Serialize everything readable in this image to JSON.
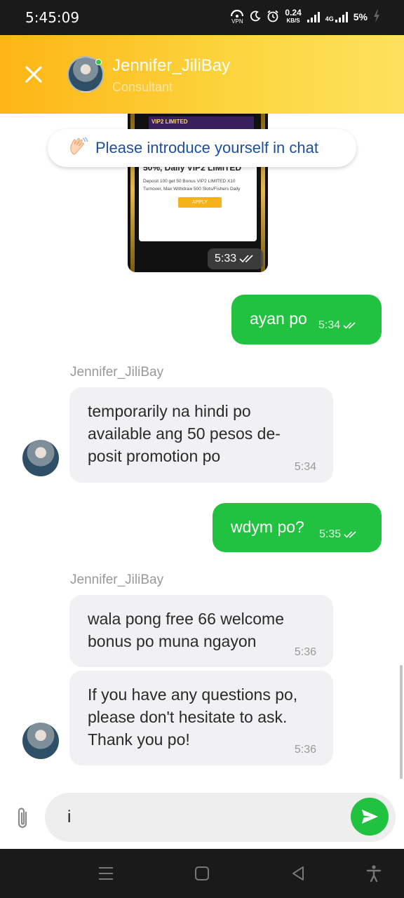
{
  "status_bar": {
    "time": "5:45:09",
    "vpn_label": "VPN",
    "speed_value": "0.24",
    "speed_unit": "KB/S",
    "network_label": "4G",
    "battery": "5%"
  },
  "header": {
    "agent_name": "Jennifer_JiliBay",
    "agent_role": "Consultant",
    "accent": "#fdb515"
  },
  "intro_banner": {
    "icon": "waving-hand-icon",
    "text": "Please introduce yourself in chat"
  },
  "image_message": {
    "banner_text": "VIP2 LIMITED",
    "promo_title": "50%, Daily VIP2 LIMITED",
    "promo_desc": "Deposit 100 get 50 Bonus VIP2 LIMITED X10 Turnover, Max Withdraw 500 Slots/Fishers Daily",
    "apply_label": "APPLY",
    "time": "5:33"
  },
  "messages": [
    {
      "direction": "out",
      "text": "ayan po",
      "time": "5:34"
    },
    {
      "direction": "in",
      "sender": "Jennifer_JiliBay",
      "text": "temporarily na hindi po available ang 50 pesos de-posit promotion po",
      "time": "5:34"
    },
    {
      "direction": "out",
      "text": "wdym po?",
      "time": "5:35"
    },
    {
      "direction": "in",
      "sender": "Jennifer_JiliBay",
      "text": "wala pong free 66 welcome bonus po muna ngayon",
      "time": "5:36"
    },
    {
      "direction": "in",
      "text": "If you have any questions po, please don't hesitate to ask. Thank you po!",
      "time": "5:36"
    }
  ],
  "composer": {
    "input_value": "i",
    "send_color": "#22c241"
  },
  "colors": {
    "outgoing_bubble": "#22c241",
    "incoming_bubble": "#f1f1f3",
    "intro_text": "#1d4fa0"
  }
}
